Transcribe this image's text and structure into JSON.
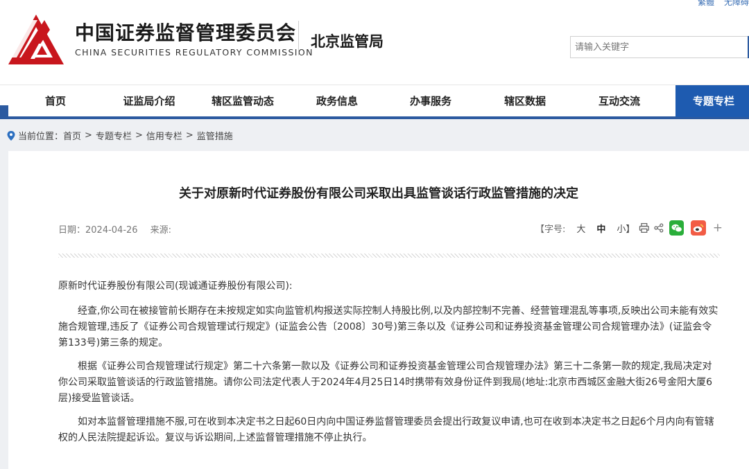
{
  "header": {
    "top_links": [
      "繁體",
      "无障碍"
    ],
    "org_name_cn": "中国证券监督管理委员会",
    "org_name_en": "CHINA SECURITIES REGULATORY COMMISSION",
    "bureau": "北京监管局",
    "search_placeholder": "请输入关键字",
    "brand_color": "#c8161d"
  },
  "nav": {
    "items": [
      {
        "label": "首页"
      },
      {
        "label": "证监局介绍"
      },
      {
        "label": "辖区监管动态"
      },
      {
        "label": "政务信息"
      },
      {
        "label": "办事服务"
      },
      {
        "label": "辖区数据"
      },
      {
        "label": "互动交流"
      },
      {
        "label": "专题专栏"
      }
    ],
    "active_color": "#1e5bb0"
  },
  "breadcrumb": {
    "prefix": "当前位置：",
    "items": [
      "首页",
      "专题专栏",
      "信用专栏",
      "监管措施"
    ],
    "separator": ">"
  },
  "article": {
    "title": "关于对原新时代证券股份有限公司采取出具监管谈话行政监管措施的决定",
    "date_label": "日期：",
    "date": "2024-04-26",
    "source_label": "来源:",
    "font_size_open": "【字号:",
    "font_size_large": "大",
    "font_size_medium": "中",
    "font_size_small": "小】",
    "salutation": "原新时代证券股份有限公司(现诚通证券股份有限公司):",
    "paragraphs": [
      "经查,你公司在被接管前长期存在未按规定如实向监管机构报送实际控制人持股比例,以及内部控制不完善、经营管理混乱等事项,反映出公司未能有效实施合规管理,违反了《证券公司合规管理试行规定》(证监会公告〔2008〕30号)第三条以及《证券公司和证券投资基金管理公司合规管理办法》(证监会令第133号)第三条的规定。",
      "根据《证券公司合规管理试行规定》第二十六条第一款以及《证券公司和证券投资基金管理公司合规管理办法》第三十二条第一款的规定,我局决定对你公司采取监管谈话的行政监管措施。请你公司法定代表人于2024年4月25日14时携带有效身份证件到我局(地址:北京市西城区金融大街26号金阳大厦6层)接受监管谈话。",
      "如对本监督管理措施不服,可在收到本决定书之日起60日内向中国证券监督管理委员会提出行政复议申请,也可在收到本决定书之日起6个月内向有管辖权的人民法院提起诉讼。复议与诉讼期间,上述监督管理措施不停止执行。"
    ]
  }
}
